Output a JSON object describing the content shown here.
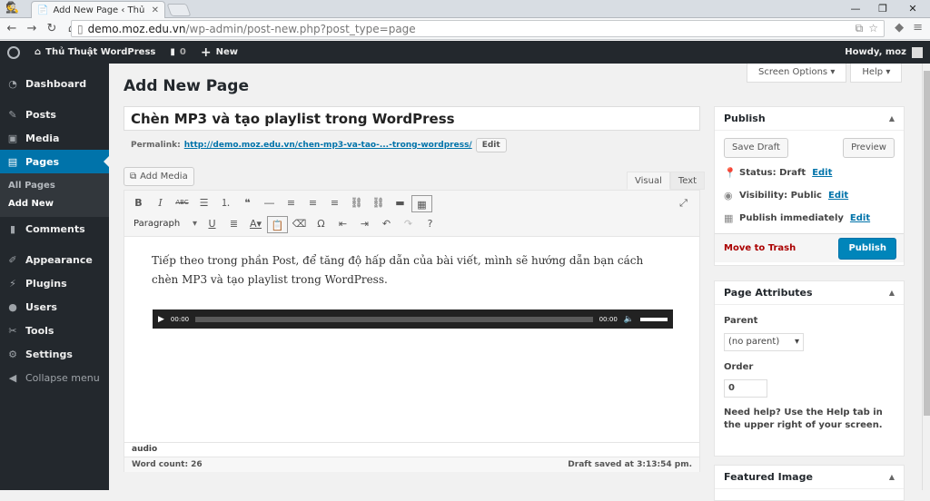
{
  "browser": {
    "tab_title": "Add New Page ‹ Thủ Thuật",
    "url_host": "demo.moz.edu.vn",
    "url_path": "/wp-admin/post-new.php?post_type=page"
  },
  "adminbar": {
    "site_name": "Thủ Thuật WordPress",
    "comments_count": "0",
    "new_label": "New",
    "howdy": "Howdy, moz"
  },
  "sidebar": {
    "dashboard": "Dashboard",
    "posts": "Posts",
    "media": "Media",
    "pages": "Pages",
    "all_pages": "All Pages",
    "add_new": "Add New",
    "comments": "Comments",
    "appearance": "Appearance",
    "plugins": "Plugins",
    "users": "Users",
    "tools": "Tools",
    "settings": "Settings",
    "collapse": "Collapse menu"
  },
  "screen_options": "Screen Options",
  "help": "Help",
  "page_title": "Add New Page",
  "post_title": "Chèn MP3 và tạo playlist trong WordPress",
  "permalink": {
    "label": "Permalink:",
    "url": "http://demo.moz.edu.vn/chen-mp3-va-tao-...-trong-wordpress/",
    "edit": "Edit"
  },
  "editor": {
    "add_media": "Add Media",
    "tab_visual": "Visual",
    "tab_text": "Text",
    "format": "Paragraph",
    "content": "Tiếp theo trong phần Post, để tăng độ hấp dẫn của bài viết, mình sẽ hướng dẫn bạn cách chèn MP3 và tạo playlist trong WordPress.",
    "audio_time_start": "00:00",
    "audio_time_end": "00:00",
    "path": "audio",
    "word_count": "Word count: 26",
    "draft_saved": "Draft saved at 3:13:54 pm."
  },
  "publish_box": {
    "title": "Publish",
    "save_draft": "Save Draft",
    "preview": "Preview",
    "status": "Status: Draft",
    "visibility": "Visibility: Public",
    "schedule": "Publish immediately",
    "edit": "Edit",
    "trash": "Move to Trash",
    "publish": "Publish"
  },
  "attributes_box": {
    "title": "Page Attributes",
    "parent_label": "Parent",
    "parent_value": "(no parent)",
    "order_label": "Order",
    "order_value": "0",
    "help": "Need help? Use the Help tab in the upper right of your screen."
  },
  "featured_box": {
    "title": "Featured Image"
  }
}
